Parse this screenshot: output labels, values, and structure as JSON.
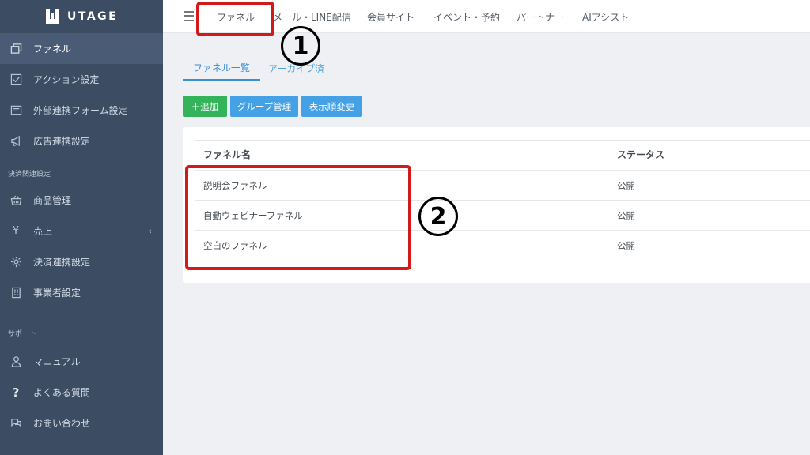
{
  "app": {
    "logo_text": "UTAGE"
  },
  "sidebar": {
    "items_top": [
      {
        "label": "ファネル",
        "icon": "window-stack-icon",
        "active": true
      },
      {
        "label": "アクション設定",
        "icon": "checklist-icon"
      },
      {
        "label": "外部連携フォーム設定",
        "icon": "form-icon"
      },
      {
        "label": "広告連携設定",
        "icon": "megaphone-icon"
      }
    ],
    "section_payment": "決済関連設定",
    "items_payment": [
      {
        "label": "商品管理",
        "icon": "basket-icon"
      },
      {
        "label": "売上",
        "icon": "yen-icon",
        "chevron": "‹"
      },
      {
        "label": "決済連携設定",
        "icon": "gear-icon"
      },
      {
        "label": "事業者設定",
        "icon": "building-icon"
      }
    ],
    "section_support": "サポート",
    "items_support": [
      {
        "label": "マニュアル",
        "icon": "person-icon"
      },
      {
        "label": "よくある質問",
        "icon": "question-icon"
      },
      {
        "label": "お問い合わせ",
        "icon": "chat-icon"
      }
    ]
  },
  "topnav": {
    "items": [
      "ファネル",
      "メール・LINE配信",
      "会員サイト",
      "イベント・予約",
      "パートナー",
      "AIアシスト"
    ]
  },
  "tabs": {
    "active": "ファネル一覧",
    "inactive": "アーカイブ済"
  },
  "buttons": {
    "add": "＋追加",
    "group": "グループ管理",
    "order": "表示順変更"
  },
  "table": {
    "headers": {
      "name": "ファネル名",
      "status": "ステータス"
    },
    "rows": [
      {
        "name": "説明会ファネル",
        "status": "公開"
      },
      {
        "name": "自動ウェビナーファネル",
        "status": "公開"
      },
      {
        "name": "空白のファネル",
        "status": "公開"
      }
    ]
  },
  "annotations": {
    "marker1": "1",
    "marker2": "2",
    "color": "#d21a1a"
  }
}
